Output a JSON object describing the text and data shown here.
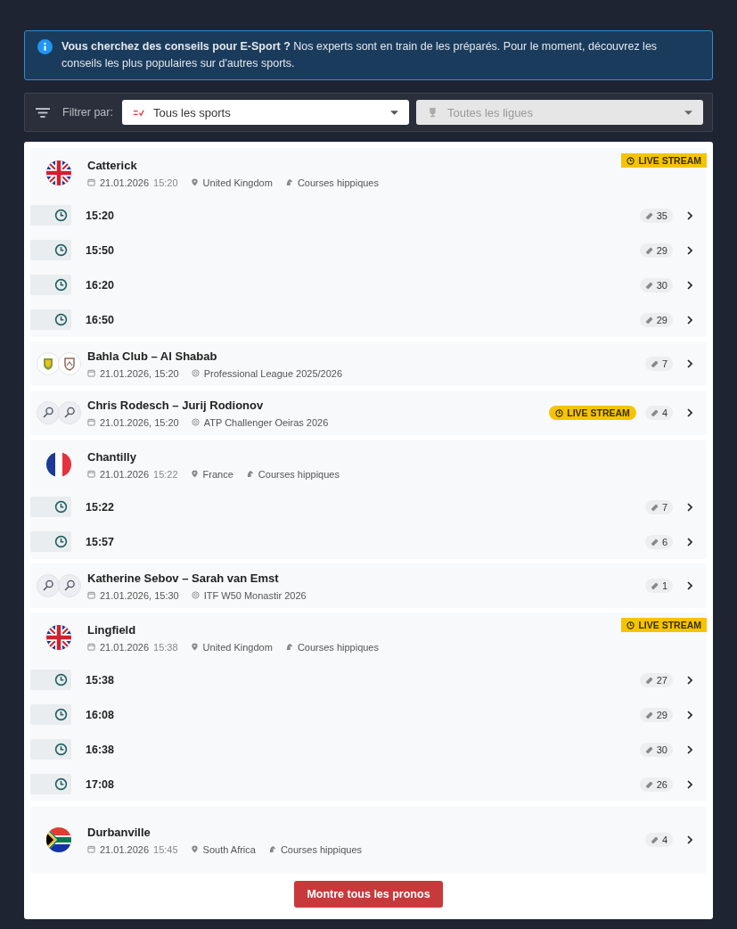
{
  "notice": {
    "text": "**Vous cherchez des conseils pour E-Sport ?** Nos experts sont en train de les préparés. Pour le moment, découvrez les conseils les plus populaires sur d'autres sports."
  },
  "filter": {
    "label": "Filtrer par:",
    "selects": [
      {
        "value": "Tous les sports",
        "disabled": false,
        "kind": "sport"
      },
      {
        "value": "Toutes les ligues",
        "disabled": true,
        "kind": "league"
      }
    ]
  },
  "events": [
    {
      "kind": "race",
      "avatar": {
        "kind": "flag_uk"
      },
      "title": "Catterick",
      "date": "21.01.2026",
      "time": "15:20",
      "place": "United Kingdom",
      "sport": "Courses hippiques",
      "badge": "LIVE STREAM",
      "races": [
        {
          "time": "15:20",
          "tips": "35"
        },
        {
          "time": "15:50",
          "tips": "29"
        },
        {
          "time": "16:20",
          "tips": "30"
        },
        {
          "time": "16:50",
          "tips": "29"
        }
      ]
    },
    {
      "kind": "match",
      "avatar": {
        "kind": "football_crests"
      },
      "title": "Bahla Club – Al Shabab",
      "datetime": "21.01.2026, 15:20",
      "league": "Professional League 2025/2026",
      "tips": "7"
    },
    {
      "kind": "match",
      "avatar": {
        "kind": "tennis_rackets"
      },
      "title": "Chris Rodesch – Jurij Rodionov",
      "datetime": "21.01.2026, 15:20",
      "league": "ATP Challenger Oeiras 2026",
      "badge": "LIVE STREAM",
      "tips": "4"
    },
    {
      "kind": "race",
      "avatar": {
        "kind": "flag_fr"
      },
      "title": "Chantilly",
      "date": "21.01.2026",
      "time": "15:22",
      "place": "France",
      "sport": "Courses hippiques",
      "races": [
        {
          "time": "15:22",
          "tips": "7"
        },
        {
          "time": "15:57",
          "tips": "6"
        }
      ]
    },
    {
      "kind": "match",
      "avatar": {
        "kind": "tennis_rackets"
      },
      "title": "Katherine Sebov – Sarah van Emst",
      "datetime": "21.01.2026, 15:30",
      "league": "ITF W50 Monastir 2026",
      "tips": "1"
    },
    {
      "kind": "race",
      "avatar": {
        "kind": "flag_uk"
      },
      "title": "Lingfield",
      "date": "21.01.2026",
      "time": "15:38",
      "place": "United Kingdom",
      "sport": "Courses hippiques",
      "badge": "LIVE STREAM",
      "races": [
        {
          "time": "15:38",
          "tips": "27"
        },
        {
          "time": "16:08",
          "tips": "29"
        },
        {
          "time": "16:38",
          "tips": "30"
        },
        {
          "time": "17:08",
          "tips": "26"
        }
      ]
    },
    {
      "kind": "race",
      "avatar": {
        "kind": "flag_za"
      },
      "title": "Durbanville",
      "date": "21.01.2026",
      "time": "15:45",
      "place": "South Africa",
      "sport": "Courses hippiques",
      "tips": "4"
    }
  ],
  "show_all_button": "Montre tous les pronos"
}
